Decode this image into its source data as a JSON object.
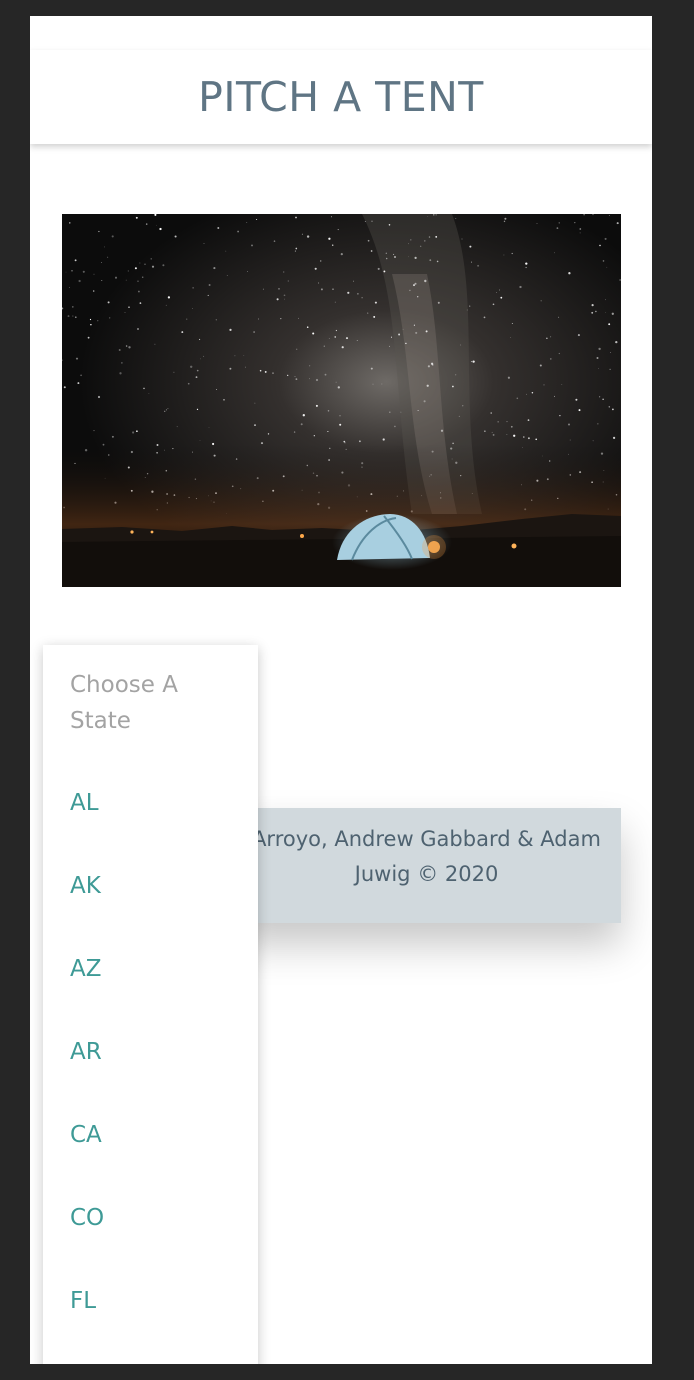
{
  "header": {
    "title": "PITCH A TENT"
  },
  "hero": {
    "alt": "Tent under the Milky Way at night"
  },
  "state_select": {
    "placeholder": "Choose A State",
    "options": [
      "AL",
      "AK",
      "AZ",
      "AR",
      "CA",
      "CO",
      "FL"
    ]
  },
  "footer": {
    "line1": "Arroyo, Andrew Gabbard & Adam",
    "line2": "Juwig © 2020"
  },
  "colors": {
    "background": "#262626",
    "title": "#5f7584",
    "option": "#3e9a96",
    "placeholder": "#a3a3a3",
    "footer_bg": "#d1d9dd"
  }
}
